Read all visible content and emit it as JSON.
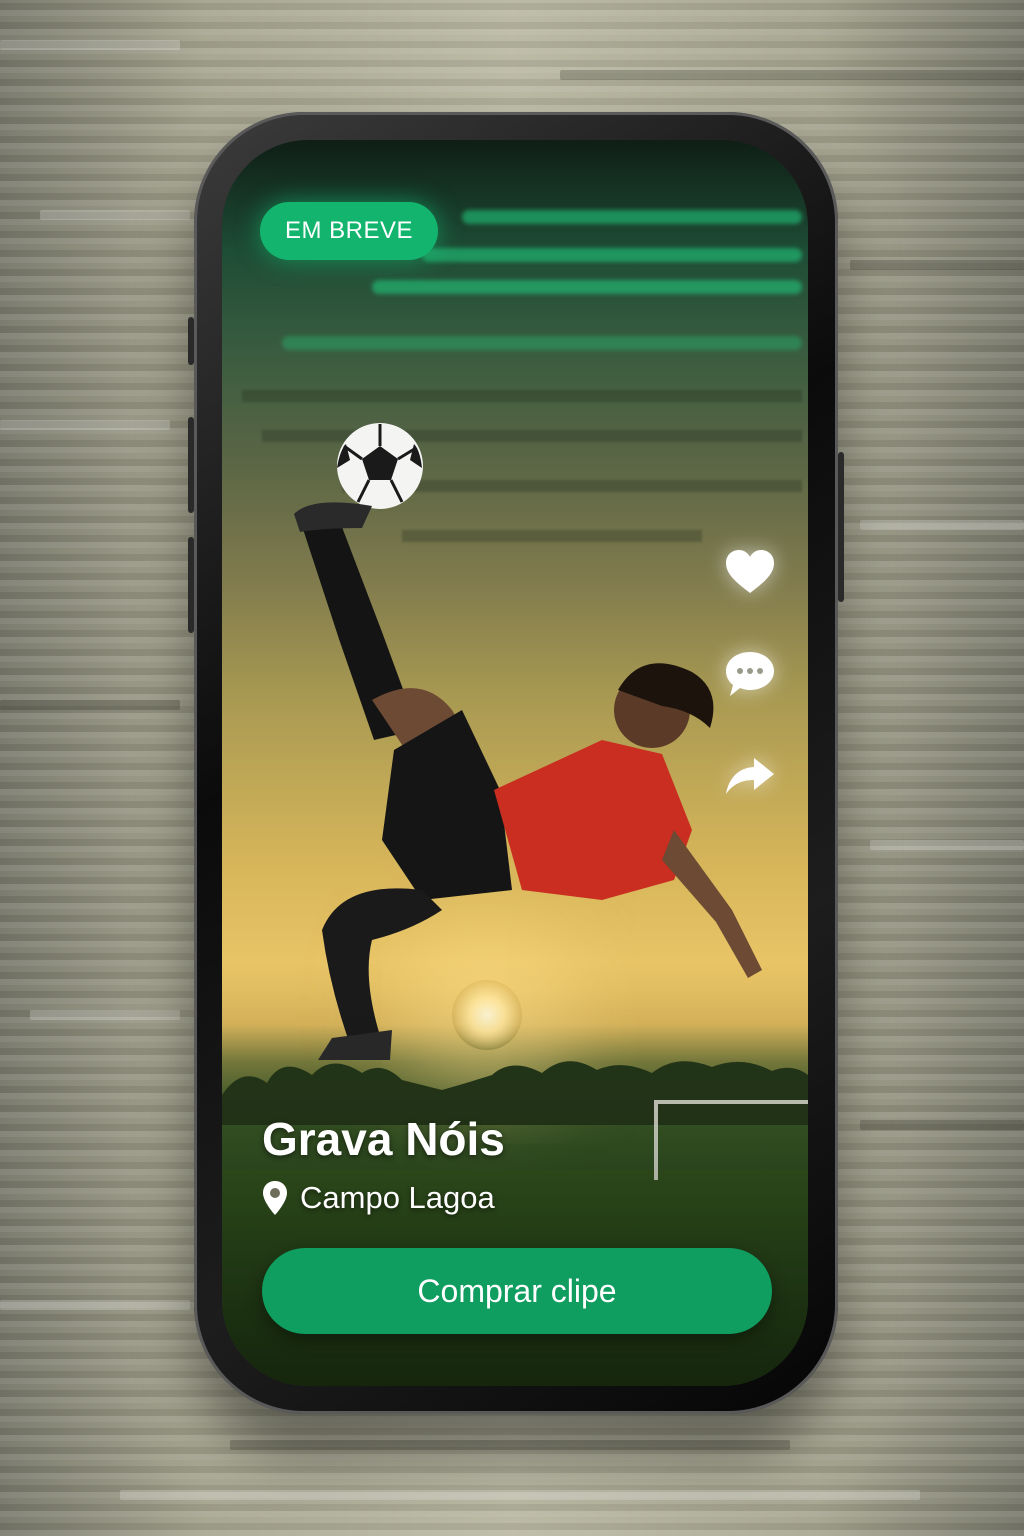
{
  "badge": {
    "label": "EM BREVE"
  },
  "actions": [
    {
      "icon": "heart-icon"
    },
    {
      "icon": "comment-icon"
    },
    {
      "icon": "share-icon"
    }
  ],
  "clip": {
    "title": "Grava Nóis",
    "location": "Campo Lagoa",
    "location_icon": "map-pin-icon"
  },
  "buy_button": {
    "label": "Comprar clipe"
  },
  "colors": {
    "accent": "#13b46e",
    "button": "#0f9d60"
  }
}
